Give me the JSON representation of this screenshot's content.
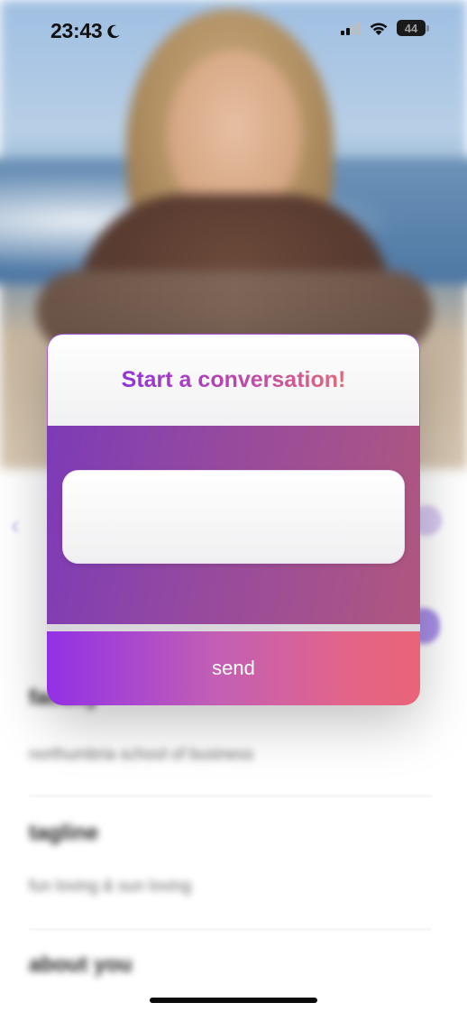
{
  "status_bar": {
    "time": "23:43",
    "battery": "44",
    "icons": [
      "moon-icon",
      "signal-icon",
      "wifi-icon",
      "battery-icon"
    ]
  },
  "modal": {
    "title": "Start a conversation!",
    "input_value": "",
    "send_label": "send"
  },
  "background_profile": {
    "fields": [
      {
        "label": "",
        "value": ""
      },
      {
        "label": "faculty",
        "value": "northumbria school of business"
      },
      {
        "label": "tagline",
        "value": "fun loving & sun loving"
      },
      {
        "label": "about you",
        "value": ""
      }
    ]
  },
  "colors": {
    "gradient_start": "#9230e6",
    "gradient_end": "#ea6477",
    "title_start": "#9133d9",
    "title_end": "#e06a7a"
  }
}
